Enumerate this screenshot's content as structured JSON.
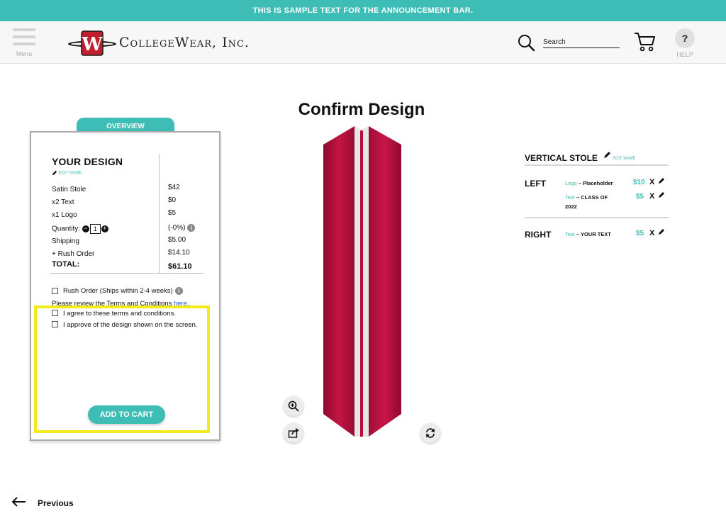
{
  "announcement": "THIS IS SAMPLE TEXT FOR THE ANNOUNCEMENT BAR.",
  "header": {
    "menu_label": "Menu",
    "logo_letter": "W",
    "brand": "CollegeWear, Inc.",
    "search_placeholder": "Search",
    "help_symbol": "?",
    "help_label": "HELP"
  },
  "page_title": "Confirm Design",
  "overview": {
    "tab_label": "OVERVIEW",
    "heading": "YOUR DESIGN",
    "edit_name": "EDIT NAME",
    "rows": [
      {
        "label": "Satin Stole",
        "value": "$42"
      },
      {
        "label": "x2 Text",
        "value": "$0"
      },
      {
        "label": "x1 Logo",
        "value": "$5"
      },
      {
        "label": "Quantity:",
        "value": "(-0%)"
      },
      {
        "label": "Shipping",
        "value": "$5.00"
      },
      {
        "label": "+ Rush Order",
        "value": "$14.10"
      }
    ],
    "quantity": "1",
    "total_label": "TOTAL:",
    "total_value": "$61.10",
    "rush_label": "Rush Order (Ships within 2-4 weeks)",
    "terms_prefix": "Please review the Terms and Conditions ",
    "terms_link": "here",
    "terms_suffix": ".",
    "agree_label": "I agree to these terms and conditions.",
    "approve_label": "I approve of the design shown on the screen.",
    "add_to_cart": "ADD TO CART"
  },
  "summary": {
    "title": "VERTICAL STOLE",
    "edit_name": "EDIT NAME",
    "left_label": "LEFT",
    "right_label": "RIGHT",
    "left_items": [
      {
        "type": "Logo",
        "sep": " – ",
        "name": "Placeholder",
        "price": "$10",
        "x": "X"
      },
      {
        "type": "Text",
        "sep": " – ",
        "name": "CLASS OF 2022",
        "price": "$5",
        "x": "X"
      }
    ],
    "right_items": [
      {
        "type": "Text",
        "sep": " – ",
        "name": "YOUR TEXT",
        "price": "$5",
        "x": "X"
      }
    ]
  },
  "previous": "Previous",
  "colors": {
    "accent": "#3dbdb5",
    "stole": "#b5103a",
    "highlight": "#f4ea1a",
    "link": "#2a5ad8"
  },
  "icons": [
    "menu-icon",
    "logo-icon",
    "search-icon",
    "cart-icon",
    "help-icon",
    "pencil-icon",
    "info-icon",
    "zoom-in-icon",
    "share-icon",
    "rotate-icon",
    "arrow-left-icon"
  ]
}
